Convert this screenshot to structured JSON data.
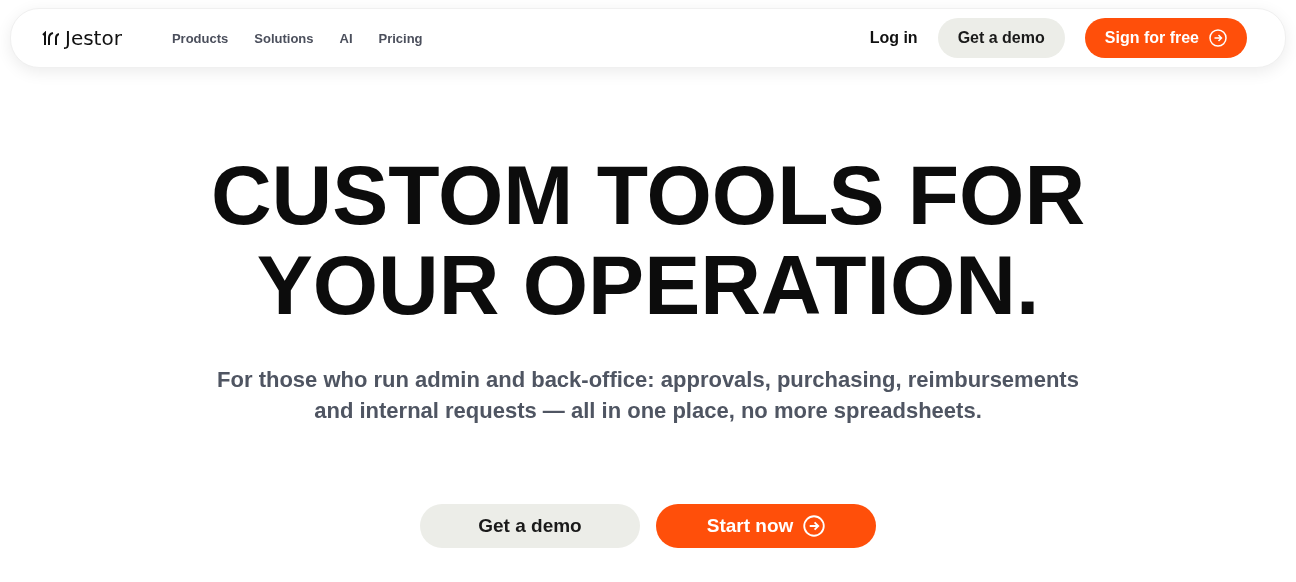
{
  "header": {
    "logo": "Jestor",
    "nav": [
      "Products",
      "Solutions",
      "AI",
      "Pricing"
    ],
    "actions": [
      {
        "label": "Log in",
        "kind": "link"
      },
      {
        "label": "Get a demo",
        "kind": "secondary"
      },
      {
        "label": "Sign for free",
        "kind": "primary"
      }
    ]
  },
  "hero": {
    "title": "CUSTOM TOOLS FOR YOUR OPERATION.",
    "subtitle": "For those who run admin and back-office: approvals, purchasing, reimbursements and internal requests — all in one place, no more spreadsheets.",
    "buttons": [
      {
        "label": "Get a demo",
        "kind": "secondary"
      },
      {
        "label": "Start now",
        "kind": "primary"
      }
    ]
  }
}
